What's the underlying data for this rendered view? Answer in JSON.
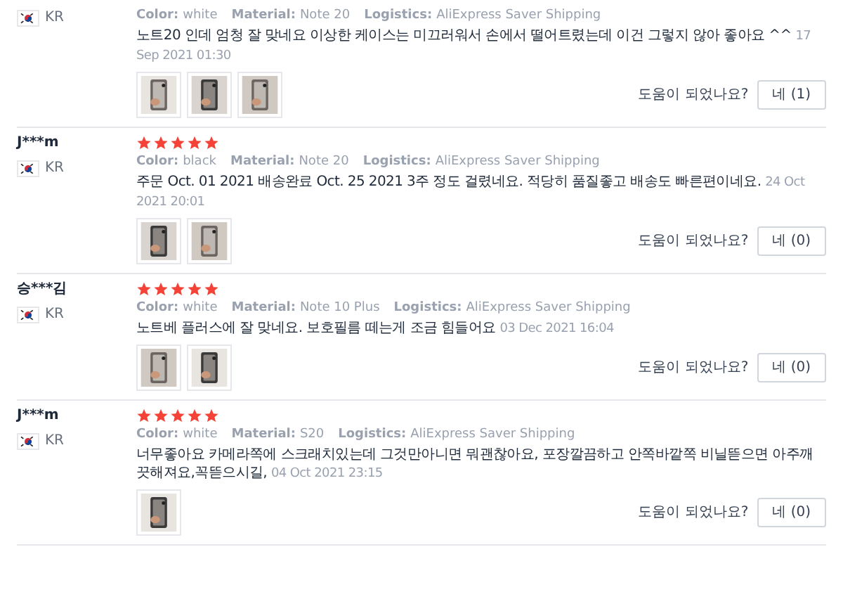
{
  "reviews": [
    {
      "country": "KR",
      "attributes": [
        {
          "label": "Color:",
          "value": "white"
        },
        {
          "label": "Material:",
          "value": "Note 20"
        },
        {
          "label": "Logistics:",
          "value": "AliExpress Saver Shipping"
        }
      ],
      "text": "노트20 인데 엄청 잘 맞네요 이상한 케이스는 미끄러워서 손에서 떨어트렸는데 이건 그렇지 않아 좋아요 ^^",
      "date": "17 Sep 2021 01:30",
      "photos": [
        {
          "kind": "picture"
        },
        {
          "kind": "picture"
        },
        {
          "kind": "picture"
        }
      ],
      "helpful_prompt": "도움이 되었나요?",
      "helpful_button": "네 (1)"
    },
    {
      "name": "J***m",
      "stars": 5,
      "country": "KR",
      "attributes": [
        {
          "label": "Color:",
          "value": "black"
        },
        {
          "label": "Material:",
          "value": "Note 20"
        },
        {
          "label": "Logistics:",
          "value": "AliExpress Saver Shipping"
        }
      ],
      "text": "주문 Oct. 01 2021 배송완료 Oct. 25 2021 3주 정도 걸렸네요. 적당히 품질좋고 배송도 빠른편이네요.",
      "date": "24 Oct 2021 20:01",
      "photos": [
        {
          "kind": "picture"
        },
        {
          "kind": "picture"
        }
      ],
      "helpful_prompt": "도움이 되었나요?",
      "helpful_button": "네 (0)"
    },
    {
      "name": "승***김",
      "stars": 5,
      "country": "KR",
      "attributes": [
        {
          "label": "Color:",
          "value": "white"
        },
        {
          "label": "Material:",
          "value": "Note 10 Plus"
        },
        {
          "label": "Logistics:",
          "value": "AliExpress Saver Shipping"
        }
      ],
      "text": "노트베 플러스에 잘 맞네요. 보호필름 떼는게 조금 힘들어요",
      "date": "03 Dec 2021 16:04",
      "photos": [
        {
          "kind": "picture"
        },
        {
          "kind": "picture"
        }
      ],
      "helpful_prompt": "도움이 되었나요?",
      "helpful_button": "네 (0)"
    },
    {
      "name": "J***m",
      "stars": 5,
      "country": "KR",
      "attributes": [
        {
          "label": "Color:",
          "value": "white"
        },
        {
          "label": "Material:",
          "value": "S20"
        },
        {
          "label": "Logistics:",
          "value": "AliExpress Saver Shipping"
        }
      ],
      "text": "너무좋아요 카메라쪽에 스크래치있는데 그것만아니면 뭐괜찮아요, 포장깔끔하고 안쪽바깥쪽 비닐뜯으면 아주깨끗해져요,꼭뜯으시길,",
      "date": "04 Oct 2021 23:15",
      "photos": [
        {
          "kind": "picture"
        }
      ],
      "helpful_prompt": "도움이 되었나요?",
      "helpful_button": "네 (0)"
    }
  ]
}
